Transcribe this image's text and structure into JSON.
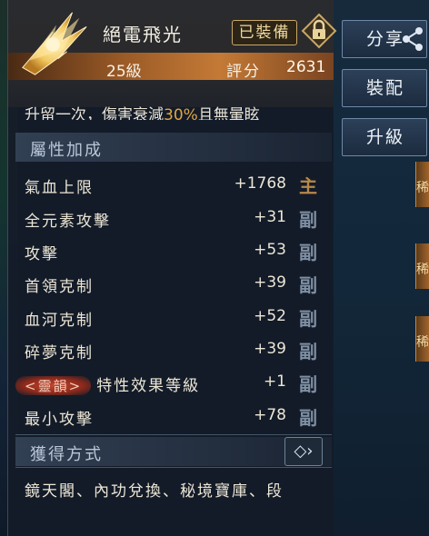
{
  "item": {
    "name": "絕電飛光",
    "equipped_badge": "已裝備",
    "level": "25級",
    "score_label": "評分",
    "score_value": "2631",
    "cut_line": {
      "prefix": "升留一次，傷害衰減",
      "highlight": "30%",
      "suffix": "且無暈眩"
    }
  },
  "attributes": {
    "title": "屬性加成",
    "rows": [
      {
        "name": "氣血上限",
        "value": "+1768",
        "tag": "主"
      },
      {
        "name": "全元素攻擊",
        "value": "+31",
        "tag": "副"
      },
      {
        "name": "攻擊",
        "value": "+53",
        "tag": "副"
      },
      {
        "name": "首領克制",
        "value": "+39",
        "tag": "副"
      },
      {
        "name": "血河克制",
        "value": "+52",
        "tag": "副"
      },
      {
        "name": "碎夢克制",
        "value": "+39",
        "tag": "副"
      },
      {
        "name": "特性效果等級",
        "value": "+1",
        "tag": "副",
        "badge": "<靈韻>"
      },
      {
        "name": "最小攻擊",
        "value": "+78",
        "tag": "副"
      }
    ]
  },
  "acquire": {
    "title": "獲得方式",
    "link_glyph": "◇›",
    "text": "鏡天閣、內功兌換、秘境寶庫、段"
  },
  "side_buttons": {
    "share": "分享",
    "equip": "裝配",
    "upgrade": "升級"
  },
  "background": {
    "strip_label": "稀"
  },
  "colors": {
    "accent_orange": "#c47a36",
    "main_tag": "#b8874a",
    "sub_tag": "#7f90a4",
    "highlight": "#e0a643"
  },
  "icons": [
    "lightning-wing-icon",
    "lock-icon",
    "share-icon",
    "link-arrow-icon"
  ]
}
